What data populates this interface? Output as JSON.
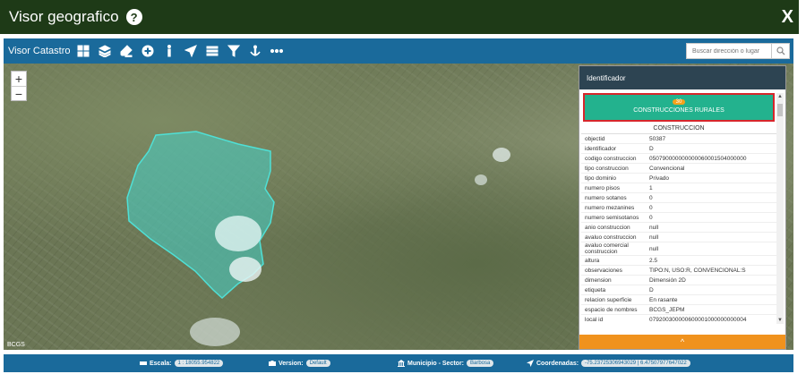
{
  "window": {
    "title": "Visor geografico",
    "help_symbol": "?",
    "close_symbol": "X"
  },
  "toolbar": {
    "app_name": "Visor Catastro",
    "tools": [
      "basemap-icon",
      "layers-icon",
      "eraser-icon",
      "add-circle-icon",
      "info-icon",
      "navigate-icon",
      "list-icon",
      "filter-icon",
      "anchor-icon",
      "more-icon"
    ],
    "search_placeholder": "Buscar dirección o lugar"
  },
  "map": {
    "zoom_in": "+",
    "zoom_out": "−",
    "credit": "BCGS"
  },
  "panel": {
    "title": "Identificador",
    "layer": {
      "count": "30",
      "name": "CONSTRUCCIONES RURALES"
    },
    "section": "CONSTRUCCION",
    "attributes": [
      {
        "key": "objectid",
        "value": "50387"
      },
      {
        "key": "identificador",
        "value": "D"
      },
      {
        "key": "codigo construccion",
        "value": "050790000000000060001504000000"
      },
      {
        "key": "tipo construccion",
        "value": "Convencional"
      },
      {
        "key": "tipo dominio",
        "value": "Privado"
      },
      {
        "key": "numero pisos",
        "value": "1"
      },
      {
        "key": "numero sotanos",
        "value": "0"
      },
      {
        "key": "numero mezanines",
        "value": "0"
      },
      {
        "key": "numero semisotanos",
        "value": "0"
      },
      {
        "key": "anio construccion",
        "value": "null"
      },
      {
        "key": "avaluo construccion",
        "value": "null"
      },
      {
        "key": "avaluo comercial construccion",
        "value": "null"
      },
      {
        "key": "altura",
        "value": "2.5"
      },
      {
        "key": "observaciones",
        "value": "TIPO:N, USO:R, CONVENCIONAL:S"
      },
      {
        "key": "dimension",
        "value": "Dimensión 2D"
      },
      {
        "key": "etiqueta",
        "value": "D"
      },
      {
        "key": "relacion superficie",
        "value": "En rasante"
      },
      {
        "key": "espacio de nombres",
        "value": "BCGS_JEPM"
      },
      {
        "key": "local id",
        "value": "079200300000600001000000000004"
      }
    ],
    "collapse_symbol": "^"
  },
  "status": {
    "scale_label": "Escala:",
    "scale_value": "1 : 18055.954822",
    "version_label": "Version:",
    "version_value": "Default",
    "municipio_label": "Municipio - Sector:",
    "municipio_value": "Barbosa",
    "coords_label": "Coordenadas:",
    "coords_value": "-75.23725306943029 | 6.47507977647022"
  }
}
